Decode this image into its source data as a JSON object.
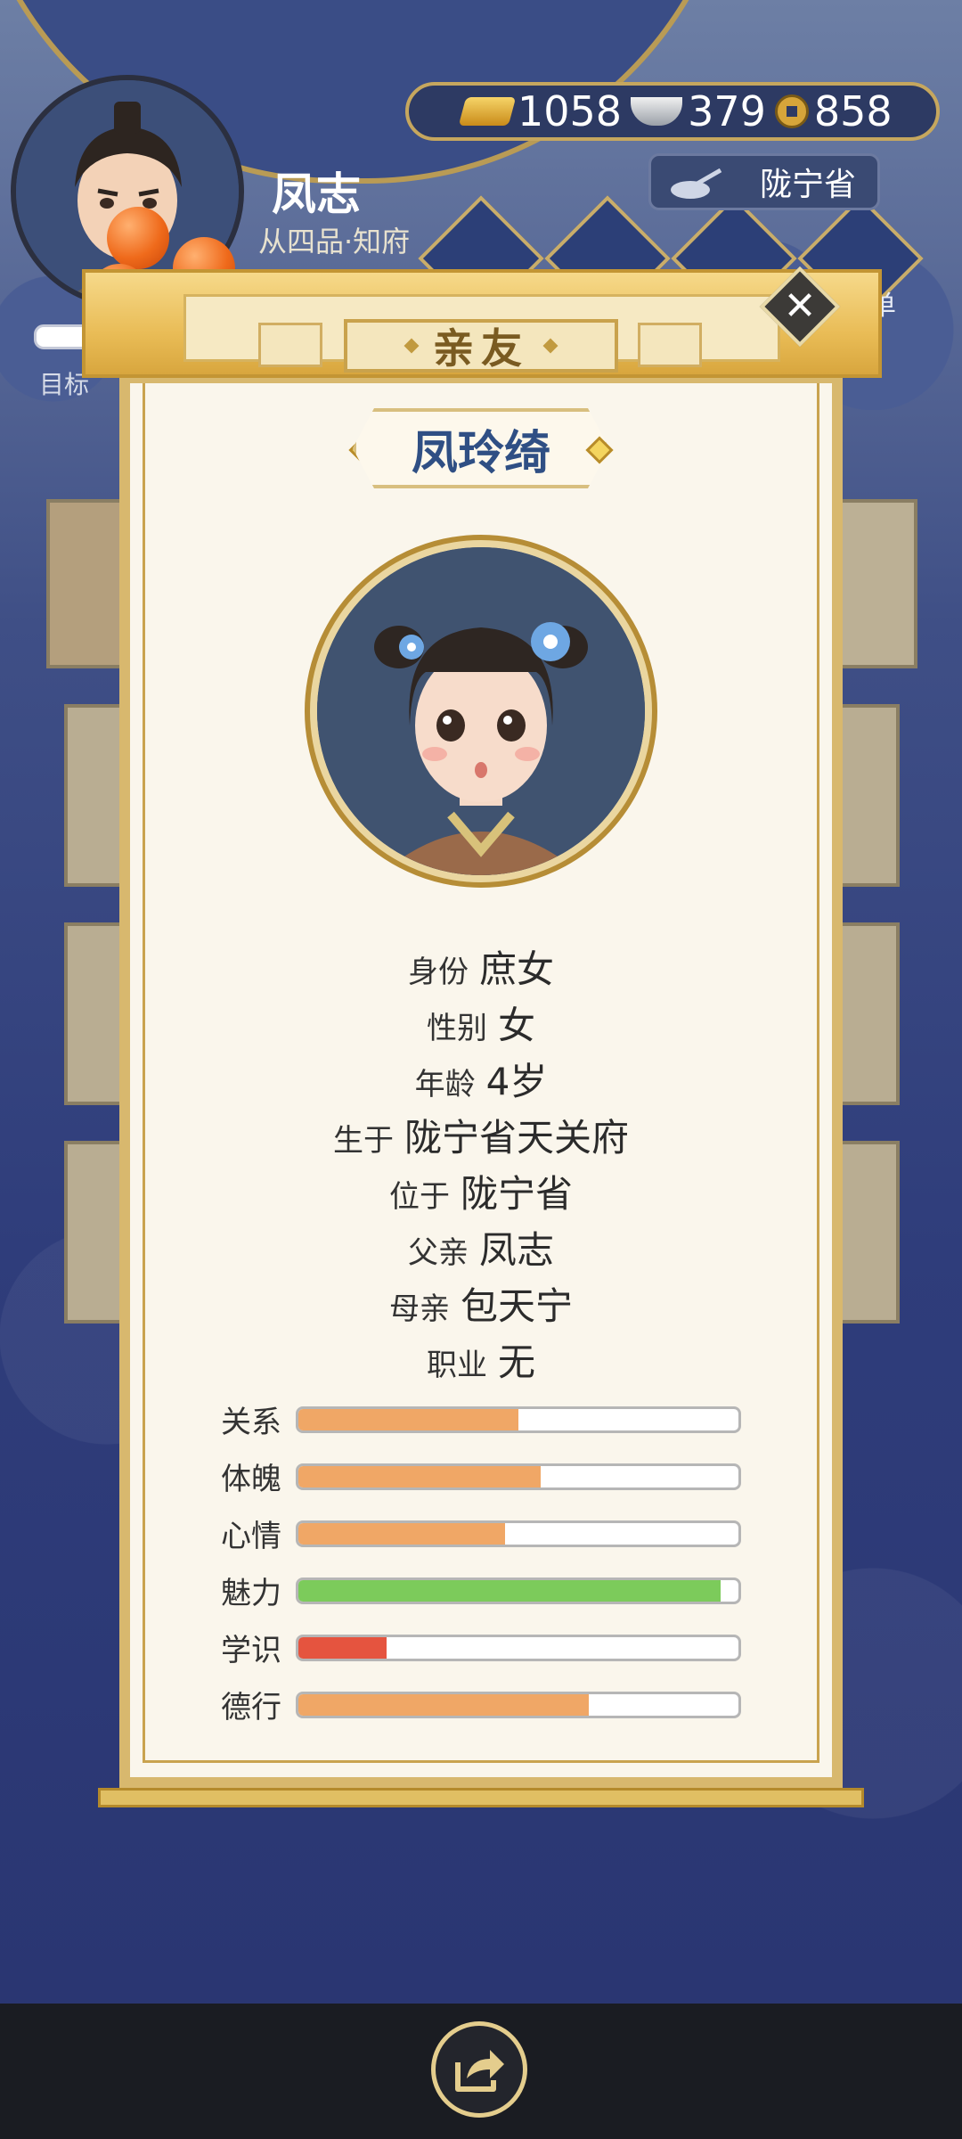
{
  "player": {
    "name": "凤志",
    "rank": "从四品·知府",
    "goal_label": "目标",
    "goal_progress": 0.65
  },
  "currency": {
    "gold": "1058",
    "silver": "379",
    "coin": "858"
  },
  "location": {
    "label": "陇宁省"
  },
  "nav_partial_label": "单",
  "modal": {
    "tab_label": "亲友",
    "close_symbol": "✕"
  },
  "person": {
    "name": "凤玲绮",
    "info": [
      {
        "label": "身份",
        "value": "庶女"
      },
      {
        "label": "性别",
        "value": "女"
      },
      {
        "label": "年龄",
        "value": "4岁"
      },
      {
        "label": "生于",
        "value": "陇宁省天关府"
      },
      {
        "label": "位于",
        "value": "陇宁省"
      },
      {
        "label": "父亲",
        "value": "凤志"
      },
      {
        "label": "母亲",
        "value": "包天宁"
      },
      {
        "label": "职业",
        "value": "无"
      }
    ],
    "stats": [
      {
        "label": "关系",
        "value": 0.5,
        "color": "#f0a766"
      },
      {
        "label": "体魄",
        "value": 0.55,
        "color": "#f0a766"
      },
      {
        "label": "心情",
        "value": 0.47,
        "color": "#f0a766"
      },
      {
        "label": "魅力",
        "value": 0.96,
        "color": "#7ccb5b"
      },
      {
        "label": "学识",
        "value": 0.2,
        "color": "#e5543f"
      },
      {
        "label": "德行",
        "value": 0.66,
        "color": "#f0a766"
      }
    ]
  }
}
